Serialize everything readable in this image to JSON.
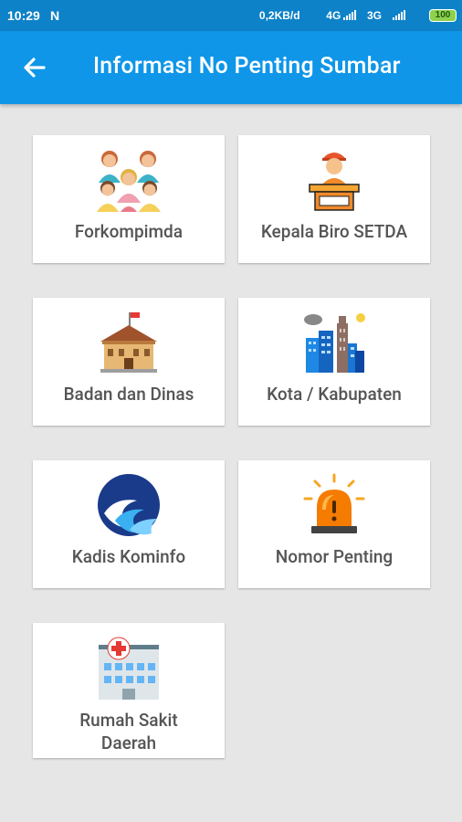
{
  "status_bar": {
    "time": "10:29",
    "notification": "N",
    "network_speed": "0,2KB/d",
    "network_1": "4G",
    "network_2": "3G",
    "battery": "100"
  },
  "appbar": {
    "title": "Informasi No Penting Sumbar",
    "back_icon": "arrow-left-icon"
  },
  "menu": [
    {
      "label": "Forkompimda",
      "icon": "people-group-icon"
    },
    {
      "label": "Kepala Biro SETDA",
      "icon": "speaker-podium-icon"
    },
    {
      "label": "Badan dan Dinas",
      "icon": "government-building-icon"
    },
    {
      "label": "Kota / Kabupaten",
      "icon": "city-skyline-icon"
    },
    {
      "label": "Kadis Kominfo",
      "icon": "kominfo-logo-icon"
    },
    {
      "label": "Nomor Penting",
      "icon": "emergency-siren-icon"
    },
    {
      "label_line1": "Rumah Sakit",
      "label_line2": "Daerah",
      "icon": "hospital-icon"
    }
  ],
  "colors": {
    "status_bar": "#0e82c8",
    "app_bar": "#0f96e8",
    "background": "#e6e6e6",
    "card": "#ffffff",
    "label": "#555555"
  }
}
